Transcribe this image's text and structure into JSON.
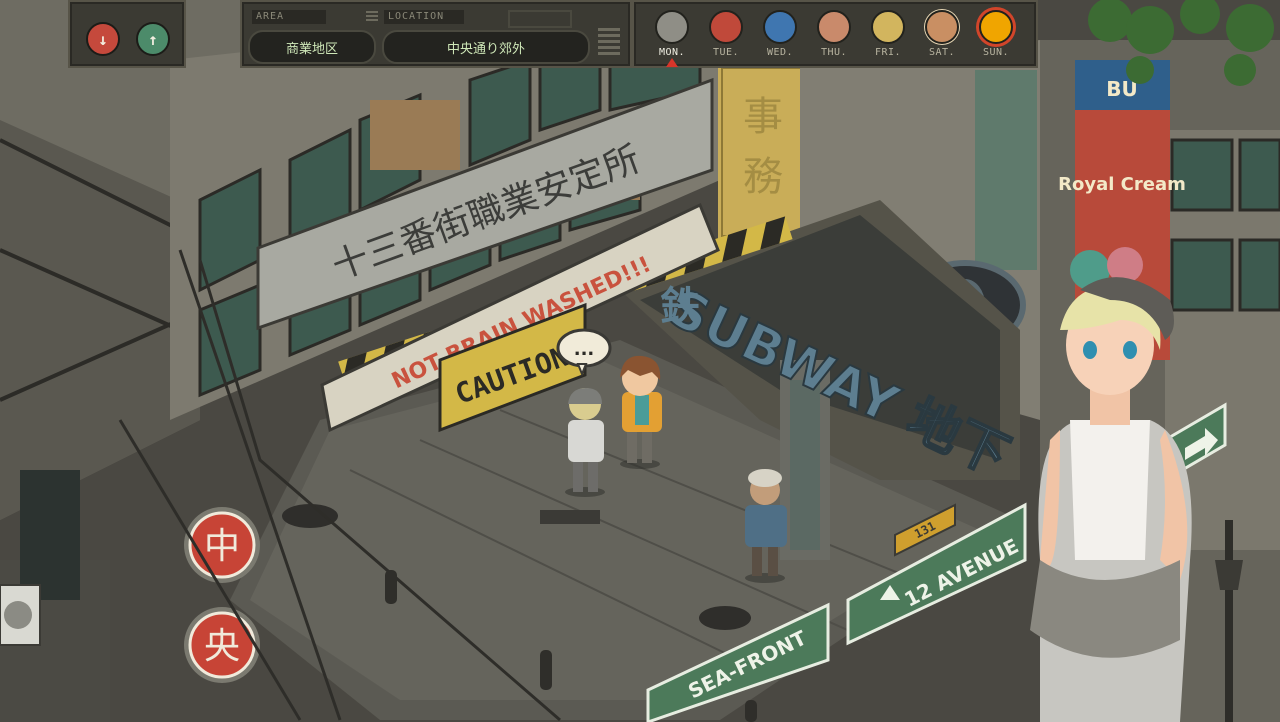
{
  "hud": {
    "area_tag": "AREA",
    "location_tag": "LOCATION",
    "area_value": "商業地区",
    "location_value": "中央通り郊外",
    "days": [
      {
        "label": "MON.",
        "color": "#8f8e86",
        "active": true
      },
      {
        "label": "TUE.",
        "color": "#c0493a"
      },
      {
        "label": "WED.",
        "color": "#3f76b0"
      },
      {
        "label": "THU.",
        "color": "#c98a6b"
      },
      {
        "label": "FRI.",
        "color": "#d2b55e"
      },
      {
        "label": "SAT.",
        "color": "#c98f63"
      },
      {
        "label": "SUN.",
        "color": "#f0a500"
      }
    ]
  },
  "scene": {
    "banner_text": "十三番街職業安定所",
    "protest_text": "NOT BRAIN WASHED!!!",
    "caution_text": "CAUTION",
    "subway_sign": "SUBWAY 地下",
    "subway_kanji": "鉄",
    "street_sign_1": "12 AVENUE",
    "street_sign_2": "SEA-FRONT",
    "small_plate": "131",
    "shop_sign_top": "BU",
    "shop_sign": "Royal Cream",
    "round_sign_1": "中",
    "round_sign_2": "央",
    "speech_bubble": "..."
  }
}
